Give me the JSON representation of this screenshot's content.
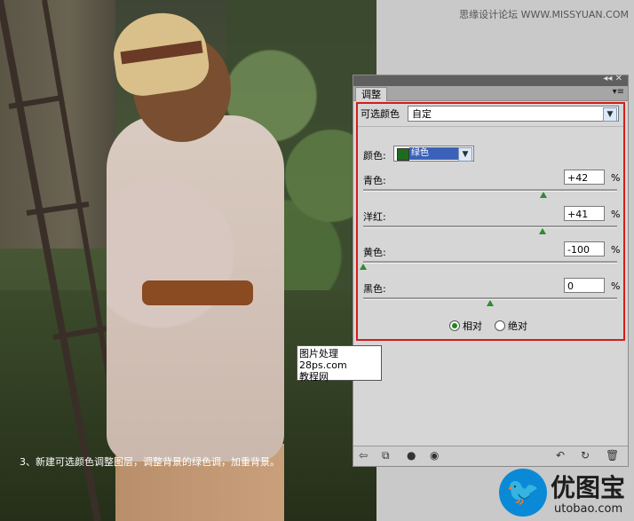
{
  "watermark": "思缘设计论坛 WWW.MISSYUAN.COM",
  "photo_caption": "3、新建可选颜色调整图层，调整背景的绿色调，加重背景。",
  "panel": {
    "tab_label": "调整",
    "title_controls": "◂◂ ✕",
    "menu_icon": "▾≡",
    "mode_label": "可选颜色",
    "preset_value": "自定",
    "colors_label": "颜色:",
    "colors_value": "绿色",
    "sliders": [
      {
        "label": "青色:",
        "value": "+42",
        "unit": "%",
        "level": 42
      },
      {
        "label": "洋红:",
        "value": "+41",
        "unit": "%",
        "level": 41
      },
      {
        "label": "黄色:",
        "value": "-100",
        "unit": "%",
        "level": -100
      },
      {
        "label": "黑色:",
        "value": "0",
        "unit": "%",
        "level": 0
      }
    ],
    "method": {
      "relative_label": "相对",
      "absolute_label": "绝对",
      "selected": "relative"
    }
  },
  "tooltip": {
    "line1": "图片处理",
    "line2": "28ps.com",
    "line3": "教程网"
  },
  "logo": {
    "cn": "优图宝",
    "en": "utobao.com"
  },
  "colors": {
    "accent_red": "#d41c1c",
    "knob_green": "#2e8b2e",
    "swatch_green": "#1e6b1e"
  }
}
